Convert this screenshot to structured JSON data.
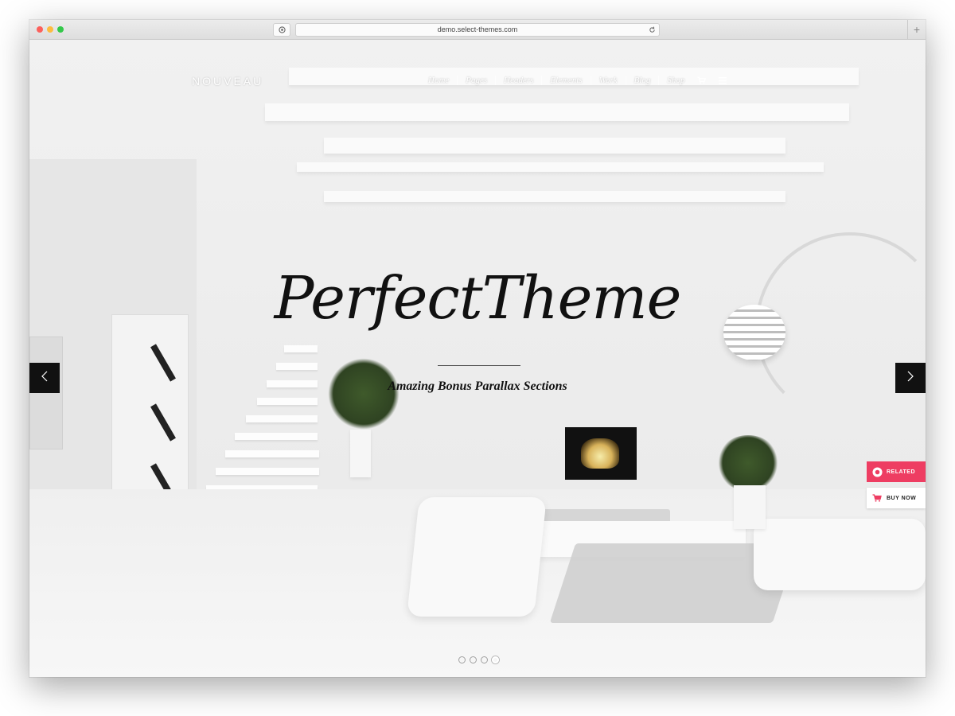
{
  "browser": {
    "url": "demo.select-themes.com"
  },
  "site": {
    "logo": "NOUVEAU",
    "nav": [
      {
        "label": "Home"
      },
      {
        "label": "Pages"
      },
      {
        "label": "Headers"
      },
      {
        "label": "Elements"
      },
      {
        "label": "Work"
      },
      {
        "label": "Blog"
      },
      {
        "label": "Shop"
      }
    ],
    "nav_icons": [
      "cart-icon",
      "menu-icon"
    ]
  },
  "hero": {
    "headline": "PerfectTheme",
    "subtitle": "Amazing Bonus Parallax Sections",
    "slider": {
      "total_slides": 4,
      "active_slide": 4
    }
  },
  "side_buttons": {
    "related": "RELATED",
    "buy_now": "BUY NOW"
  },
  "colors": {
    "accent": "#ee3d62",
    "arrow_bg": "#111111",
    "headline": "#111111"
  }
}
